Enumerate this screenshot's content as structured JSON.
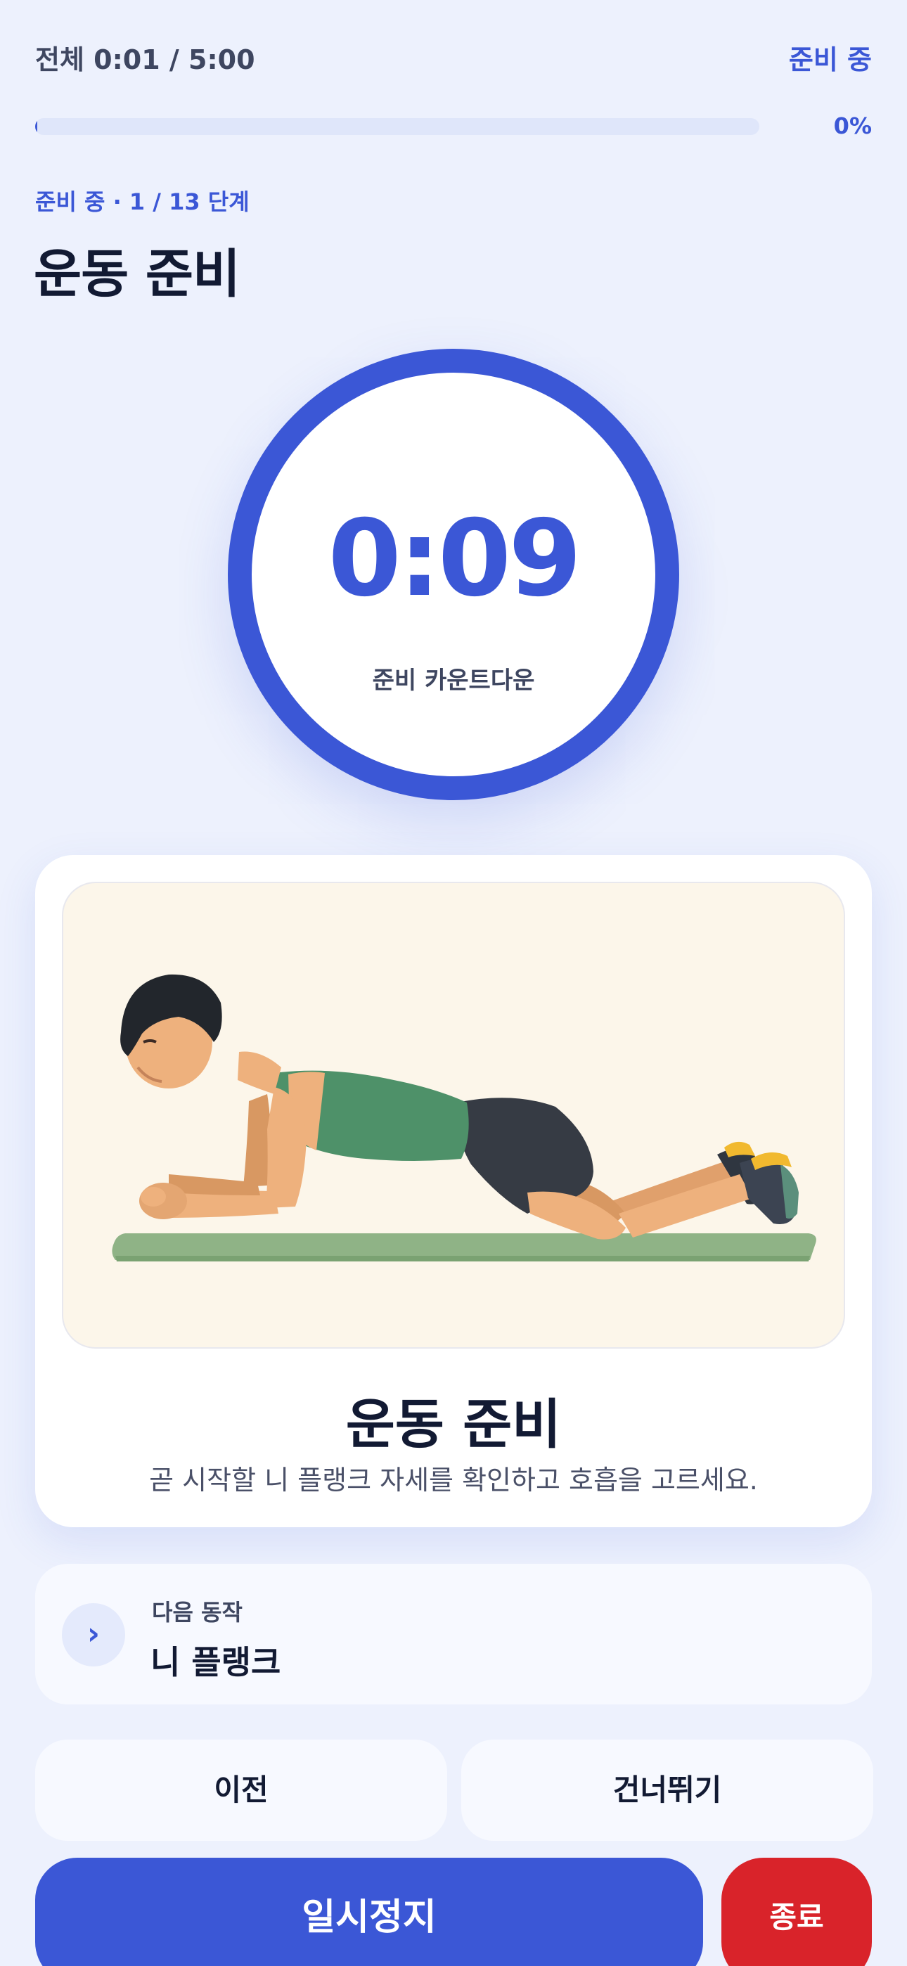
{
  "header": {
    "total_time": "전체 0:01 / 5:00",
    "status": "준비 중",
    "progress_percent_label": "0%",
    "progress_fraction": 0.003
  },
  "step": {
    "meta": "준비 중 · 1 / 13 단계",
    "title": "운동 준비"
  },
  "timer": {
    "value": "0:09",
    "label": "준비 카운트다운"
  },
  "card": {
    "illustration_icon": "knee-plank-illustration",
    "title": "운동 준비",
    "description": "곧 시작할 니 플랭크 자세를 확인하고 호흡을 고르세요."
  },
  "next": {
    "icon": "chevron-right-icon",
    "glyph": "›",
    "label": "다음 동작",
    "name": "니 플랭크"
  },
  "controls": {
    "prev_label": "이전",
    "skip_label": "건너뛰기",
    "pause_label": "일시정지",
    "end_label": "종료"
  },
  "colors": {
    "accent": "#3b57d6",
    "danger": "#d9232a",
    "background": "#edf1fd"
  }
}
